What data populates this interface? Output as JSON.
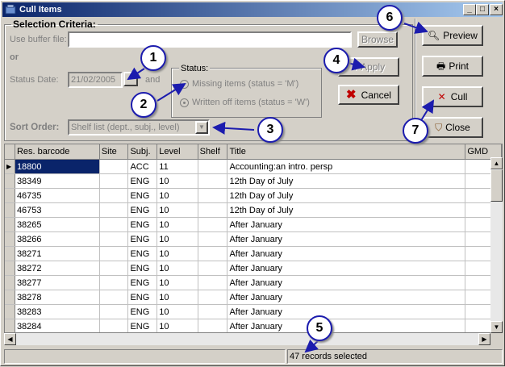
{
  "window": {
    "title": "Cull Items",
    "controls": [
      "_",
      "□",
      "×"
    ]
  },
  "criteria": {
    "legend": "Selection Criteria:",
    "buffer_label": "Use buffer file:",
    "buffer_value": "",
    "browse_label": "Browse",
    "or_label": "or",
    "status_date_label": "Status Date:",
    "status_date_value": "21/02/2005",
    "date_picker_label": "...",
    "and_label": "and",
    "status_legend": "Status:",
    "status_options": [
      "Missing items  (status = 'M')",
      "Written off items  (status = 'W')"
    ],
    "status_selected_index": 1,
    "sort_order_label": "Sort Order:",
    "sort_order_value": "Shelf list (dept., subj., level)",
    "apply_label": "Apply",
    "cancel_label": "Cancel"
  },
  "side_buttons": {
    "preview": "Preview",
    "print": "Print",
    "cull": "Cull",
    "close": "Close"
  },
  "callouts": [
    "1",
    "2",
    "3",
    "4",
    "5",
    "6",
    "7"
  ],
  "grid": {
    "columns": [
      "Res. barcode",
      "Site",
      "Subj.",
      "Level",
      "Shelf",
      "Title",
      "GMD"
    ],
    "rows": [
      [
        "18800",
        "",
        "ACC",
        "11",
        "",
        "Accounting:an intro. persp"
      ],
      [
        "38349",
        "",
        "ENG",
        "10",
        "",
        "12th Day of July"
      ],
      [
        "46735",
        "",
        "ENG",
        "10",
        "",
        "12th Day of July"
      ],
      [
        "46753",
        "",
        "ENG",
        "10",
        "",
        "12th Day of July"
      ],
      [
        "38265",
        "",
        "ENG",
        "10",
        "",
        "After January"
      ],
      [
        "38266",
        "",
        "ENG",
        "10",
        "",
        "After January"
      ],
      [
        "38271",
        "",
        "ENG",
        "10",
        "",
        "After January"
      ],
      [
        "38272",
        "",
        "ENG",
        "10",
        "",
        "After January"
      ],
      [
        "38277",
        "",
        "ENG",
        "10",
        "",
        "After January"
      ],
      [
        "38278",
        "",
        "ENG",
        "10",
        "",
        "After January"
      ],
      [
        "38283",
        "",
        "ENG",
        "10",
        "",
        "After January"
      ],
      [
        "38284",
        "",
        "ENG",
        "10",
        "",
        "After January"
      ]
    ]
  },
  "status_bar": {
    "left": "",
    "right": "47 records selected"
  },
  "colors": {
    "title_start": "#0a246a",
    "title_end": "#a6caf0",
    "callout_border": "#1c1cae",
    "arrow": "#1c1cae",
    "cancel_x": "#c00000",
    "selection": "#0a246a"
  }
}
